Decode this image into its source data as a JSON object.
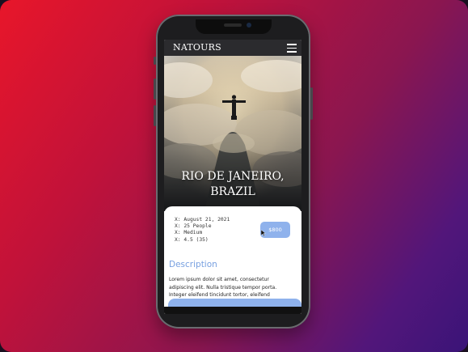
{
  "app": {
    "brand": "NATOURS",
    "icons": {
      "menu": "hamburger-menu-icon",
      "cursor": "mouse-pointer-icon"
    }
  },
  "colors": {
    "gradient_start": "#e8162a",
    "gradient_end": "#3a1478",
    "accent_blue": "#8fb2ec",
    "heading_blue": "#78a0e0",
    "nav_bg": "#2b2b2e"
  },
  "hero": {
    "title_line1": "RIO DE JANEIRO,",
    "title_line2": "BRAZIL"
  },
  "tour": {
    "details": [
      "X: August 21, 2021",
      "X: 25 People",
      "X: Medium",
      "X: 4.5 (35)"
    ],
    "price": "$800"
  },
  "description": {
    "heading": "Description",
    "lines": [
      "Lorem ipsum dolor sit amet, consectetur",
      "adipiscing elit. Nulla tristique tempor porta.",
      "Integer eleifend tincidunt tortor, eleifend"
    ]
  }
}
